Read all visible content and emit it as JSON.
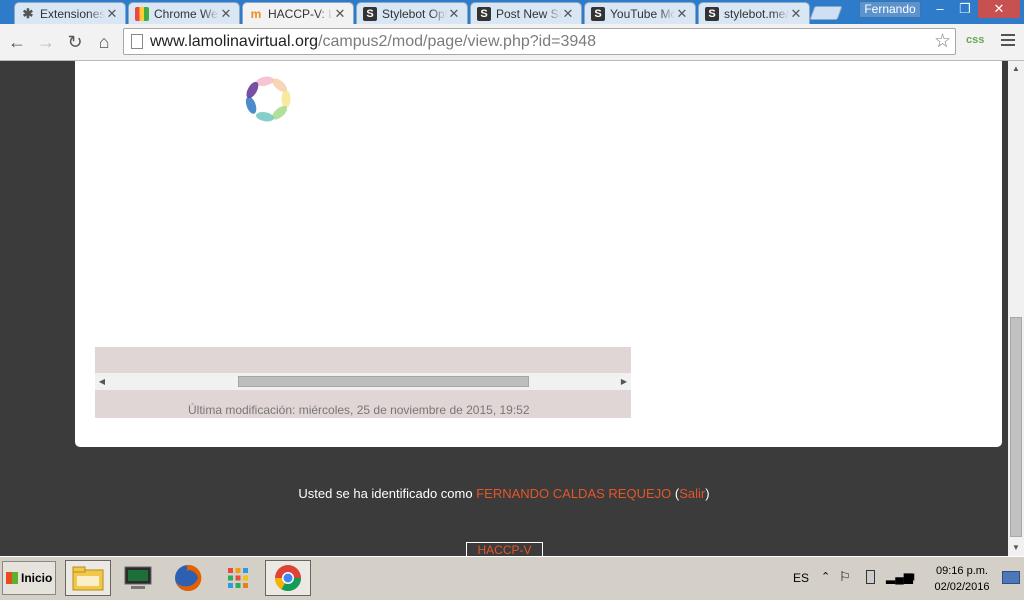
{
  "browser": {
    "tabs": [
      {
        "label": "Extensiones",
        "icon": "puzzle-icon",
        "active": false
      },
      {
        "label": "Chrome Web Store",
        "icon": "webstore-icon",
        "active": false
      },
      {
        "label": "HACCP-V: Limpieza",
        "icon": "moodle-icon",
        "active": true
      },
      {
        "label": "Stylebot Options",
        "icon": "stylebot-icon",
        "active": false
      },
      {
        "label": "Post New Style",
        "icon": "stylebot-icon",
        "active": false
      },
      {
        "label": "YouTube Mobile",
        "icon": "stylebot-icon",
        "active": false
      },
      {
        "label": "stylebot.me/styles",
        "icon": "stylebot-icon",
        "active": false
      }
    ],
    "profile_name": "Fernando",
    "window_controls": {
      "minimize": "–",
      "maximize": "❐",
      "close": "✕"
    },
    "url_host": "www.lamolinavirtual.org",
    "url_path": "/campus2/mod/page/view.php?id=3948",
    "extension_label": "css"
  },
  "page": {
    "last_modified": "Última modificación: miércoles, 25 de noviembre de 2015, 19:52",
    "login_prefix": "Usted se ha identificado como ",
    "login_user": "FERNANDO CALDAS REQUEJO",
    "login_paren_open": " (",
    "logout_label": "Salir",
    "login_paren_close": ")",
    "footer_link": "HACCP-V"
  },
  "taskbar": {
    "start_label": "Inicio",
    "apps": [
      "file-explorer-icon",
      "monitor-icon",
      "firefox-icon",
      "apps-grid-icon",
      "chrome-icon"
    ],
    "language": "ES",
    "time": "09:16 p.m.",
    "date": "02/02/2016"
  }
}
